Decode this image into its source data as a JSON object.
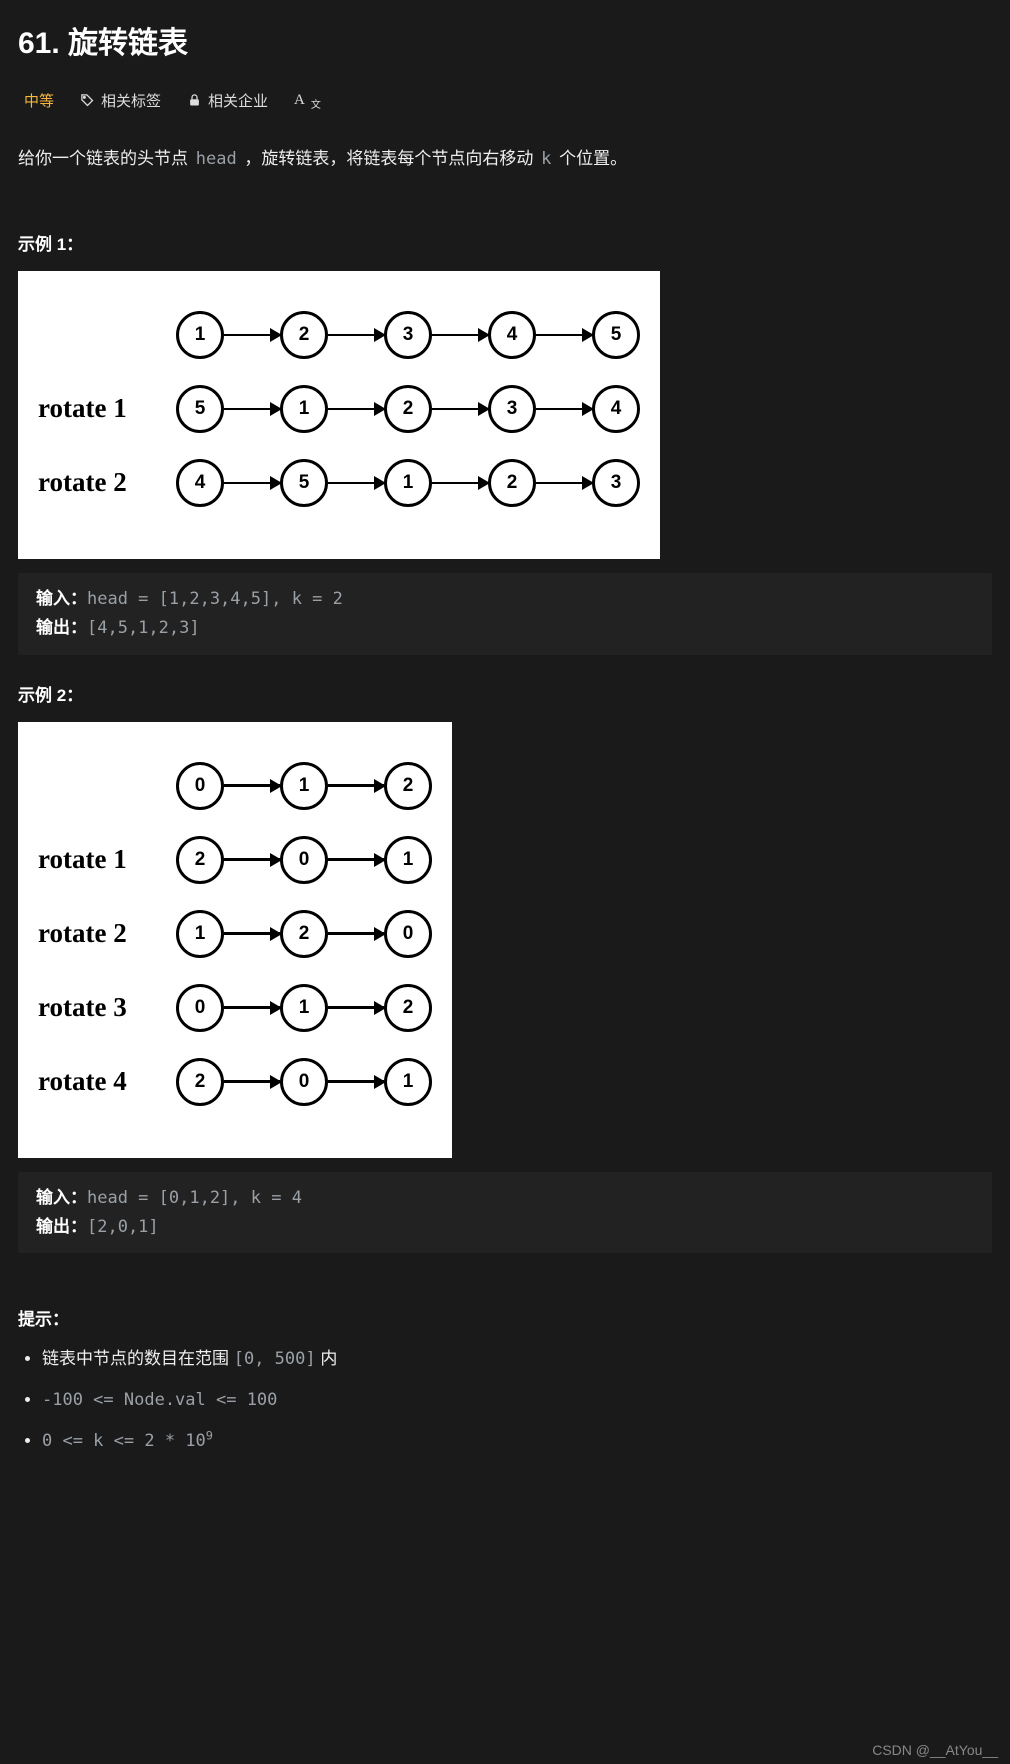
{
  "title": "61. 旋转链表",
  "meta": {
    "difficulty": "中等",
    "tags_label": "相关标签",
    "companies_label": "相关企业",
    "az_label": "A文"
  },
  "description": {
    "pre": "给你一个链表的头节点 ",
    "code1": "head",
    "mid": " ，旋转链表，将链表每个节点向右移动 ",
    "code2": "k",
    "post": " 个位置。"
  },
  "examples": [
    {
      "heading": "示例 1：",
      "diagram": {
        "label_prefix": "rotate ",
        "rows": [
          {
            "label": "",
            "nodes": [
              "1",
              "2",
              "3",
              "4",
              "5"
            ]
          },
          {
            "label": "rotate 1",
            "nodes": [
              "5",
              "1",
              "2",
              "3",
              "4"
            ]
          },
          {
            "label": "rotate 2",
            "nodes": [
              "4",
              "5",
              "1",
              "2",
              "3"
            ]
          }
        ]
      },
      "input_label": "输入：",
      "input_value": "head = [1,2,3,4,5], k = 2",
      "output_label": "输出：",
      "output_value": "[4,5,1,2,3]"
    },
    {
      "heading": "示例 2：",
      "diagram": {
        "label_prefix": "rotate ",
        "rows": [
          {
            "label": "",
            "nodes": [
              "0",
              "1",
              "2"
            ]
          },
          {
            "label": "rotate 1",
            "nodes": [
              "2",
              "0",
              "1"
            ]
          },
          {
            "label": "rotate 2",
            "nodes": [
              "1",
              "2",
              "0"
            ]
          },
          {
            "label": "rotate 3",
            "nodes": [
              "0",
              "1",
              "2"
            ]
          },
          {
            "label": "rotate 4",
            "nodes": [
              "2",
              "0",
              "1"
            ]
          }
        ]
      },
      "input_label": "输入：",
      "input_value": "head = [0,1,2], k = 4",
      "output_label": "输出：",
      "output_value": "[2,0,1]"
    }
  ],
  "hints": {
    "heading": "提示：",
    "items": [
      {
        "pre": "链表中节点的数目在范围 ",
        "code": "[0, 500]",
        "post": " 内"
      },
      {
        "pre": "",
        "code": "-100 <= Node.val <= 100",
        "post": ""
      },
      {
        "pre": "",
        "code_html": "0 <= k <= 2 * 10<sup>9</sup>",
        "post": ""
      }
    ]
  },
  "watermark": "CSDN @__AtYou__"
}
